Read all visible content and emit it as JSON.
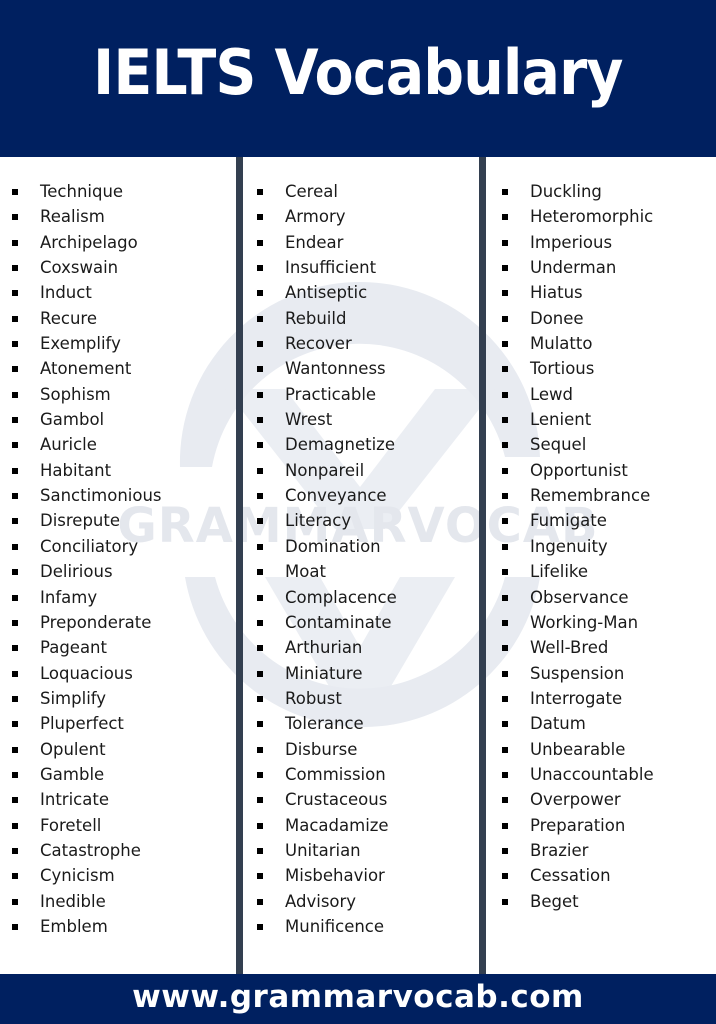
{
  "header": {
    "title": "IELTS Vocabulary"
  },
  "watermark": {
    "text": "GRAMMARVOCAB"
  },
  "columns": [
    {
      "words": [
        "Technique",
        "Realism",
        "Archipelago",
        "Coxswain",
        "Induct",
        "Recure",
        "Exemplify",
        "Atonement",
        "Sophism",
        "Gambol",
        "Auricle",
        "Habitant",
        "Sanctimonious",
        "Disrepute",
        "Conciliatory",
        "Delirious",
        "Infamy",
        "Preponderate",
        "Pageant",
        "Loquacious",
        "Simplify",
        "Pluperfect",
        "Opulent",
        "Gamble",
        "Intricate",
        "Foretell",
        "Catastrophe",
        "Cynicism",
        "Inedible",
        "Emblem"
      ]
    },
    {
      "words": [
        "Cereal",
        "Armory",
        "Endear",
        "Insufficient",
        "Antiseptic",
        "Rebuild",
        "Recover",
        "Wantonness",
        "Practicable",
        "Wrest",
        "Demagnetize",
        "Nonpareil",
        "Conveyance",
        "Literacy",
        "Domination",
        "Moat",
        "Complacence",
        "Contaminate",
        "Arthurian",
        "Miniature",
        "Robust",
        "Tolerance",
        "Disburse",
        "Commission",
        "Crustaceous",
        "Macadamize",
        "Unitarian",
        "Misbehavior",
        "Advisory",
        "Munificence"
      ]
    },
    {
      "words": [
        "Duckling",
        "Heteromorphic",
        "Imperious",
        "Underman",
        "Hiatus",
        "Donee",
        "Mulatto",
        "Tortious",
        "Lewd",
        "Lenient",
        "Sequel",
        "Opportunist",
        "Remembrance",
        "Fumigate",
        "Ingenuity",
        "Lifelike",
        "Observance",
        "Working-Man",
        "Well-Bred",
        "Suspension",
        "Interrogate",
        "Datum",
        "Unbearable",
        "Unaccountable",
        "Overpower",
        "Preparation",
        "Brazier",
        "Cessation",
        "Beget"
      ]
    }
  ],
  "footer": {
    "url": "www.grammarvocab.com"
  },
  "colors": {
    "banner": "#002060",
    "divider": "#333f50",
    "text": "#1a1a1a",
    "watermark": "#e6e9ef"
  }
}
